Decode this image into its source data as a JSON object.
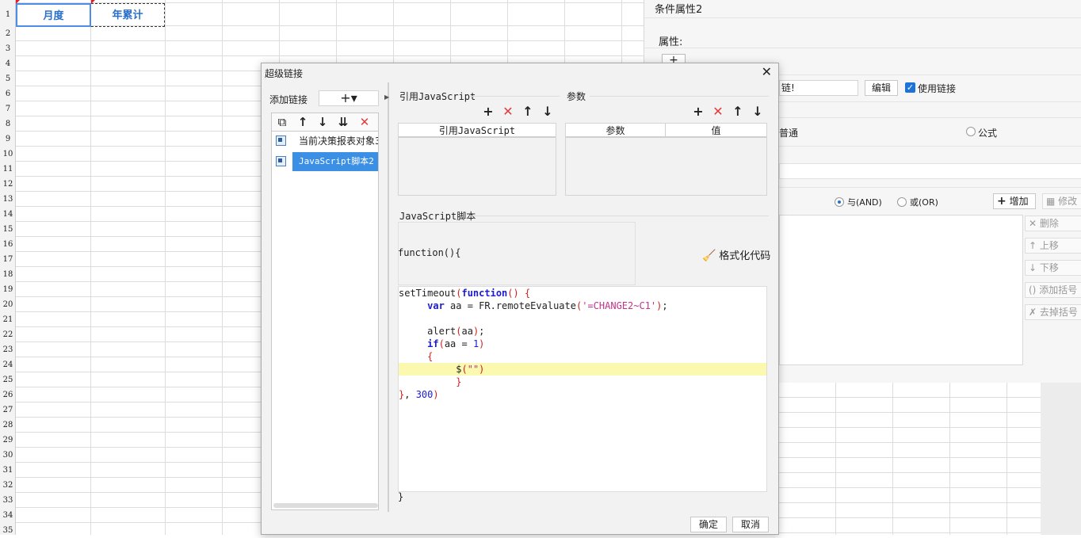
{
  "sheet": {
    "rows": [
      "1",
      "2",
      "3",
      "4",
      "5",
      "6",
      "7",
      "8",
      "9",
      "10",
      "11",
      "12",
      "13",
      "14",
      "15",
      "16",
      "17",
      "18",
      "19",
      "20",
      "21",
      "22",
      "23",
      "24",
      "25",
      "26",
      "27",
      "28",
      "29",
      "30",
      "31",
      "32",
      "33",
      "34",
      "35"
    ],
    "cell_a1": "月度",
    "cell_b1": "年累计"
  },
  "prop_panel": {
    "title": "条件属性2",
    "attr_label": "属性:",
    "add_label": "+",
    "link_text": "链!",
    "edit_button": "编辑",
    "use_link_label": "使用链接",
    "radio_normal": "普通",
    "radio_formula": "公式",
    "radio_and": "与(AND)",
    "radio_or": "或(OR)",
    "add_button": "增加",
    "modify_button": "修改",
    "side_buttons": [
      "删除",
      "上移",
      "下移",
      "添加括号",
      "去掉括号"
    ]
  },
  "dialog": {
    "title": "超级链接",
    "close_glyph": "✕",
    "add_link_label": "添加链接",
    "add_link_glyph": "+▾",
    "list_items": [
      "当前决策报表对象3",
      "JavaScript脚本2"
    ],
    "selected_index": 1,
    "ref_js_group": "引用JavaScript",
    "ref_js_column": "引用JavaScript",
    "params_group": "参数",
    "params_columns": [
      "参数",
      "值"
    ],
    "script_group": "JavaScript脚本",
    "function_header": "function(){",
    "format_code_label": "格式化代码",
    "function_footer": "}",
    "ok_button": "确定",
    "cancel_button": "取消"
  },
  "colors": {
    "accent_blue": "#3b8fe5",
    "header_text_blue": "#2a6fc9",
    "delete_red": "#e23b3b",
    "highlight_line": "#fbf8b0"
  },
  "icons": [
    "plus-icon",
    "delete-x-icon",
    "arrow-up-icon",
    "arrow-down-icon",
    "copy-icon",
    "move-bottom-icon",
    "broom-icon",
    "checkbox-icon"
  ]
}
